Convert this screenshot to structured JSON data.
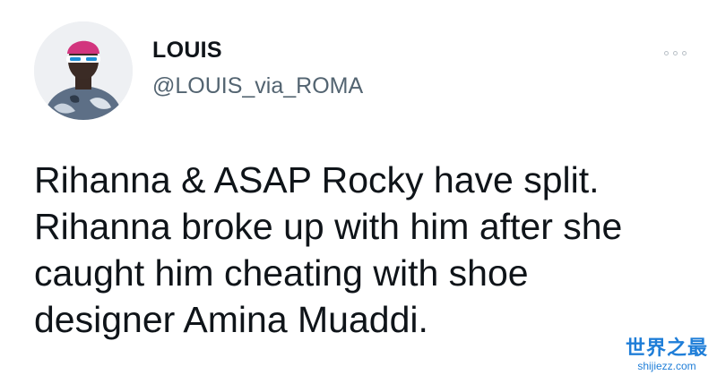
{
  "tweet": {
    "display_name": "LOUIS",
    "handle": "@LOUIS_via_ROMA",
    "text": "Rihanna & ASAP Rocky have split.\nRihanna broke up with him after she\ncaught him cheating with shoe\ndesigner Amina Muaddi.",
    "more_icon": "more-horizontal-icon"
  },
  "watermark": {
    "title": "世界之最",
    "url": "shijiezz.com",
    "color": "#1f7ed8"
  }
}
